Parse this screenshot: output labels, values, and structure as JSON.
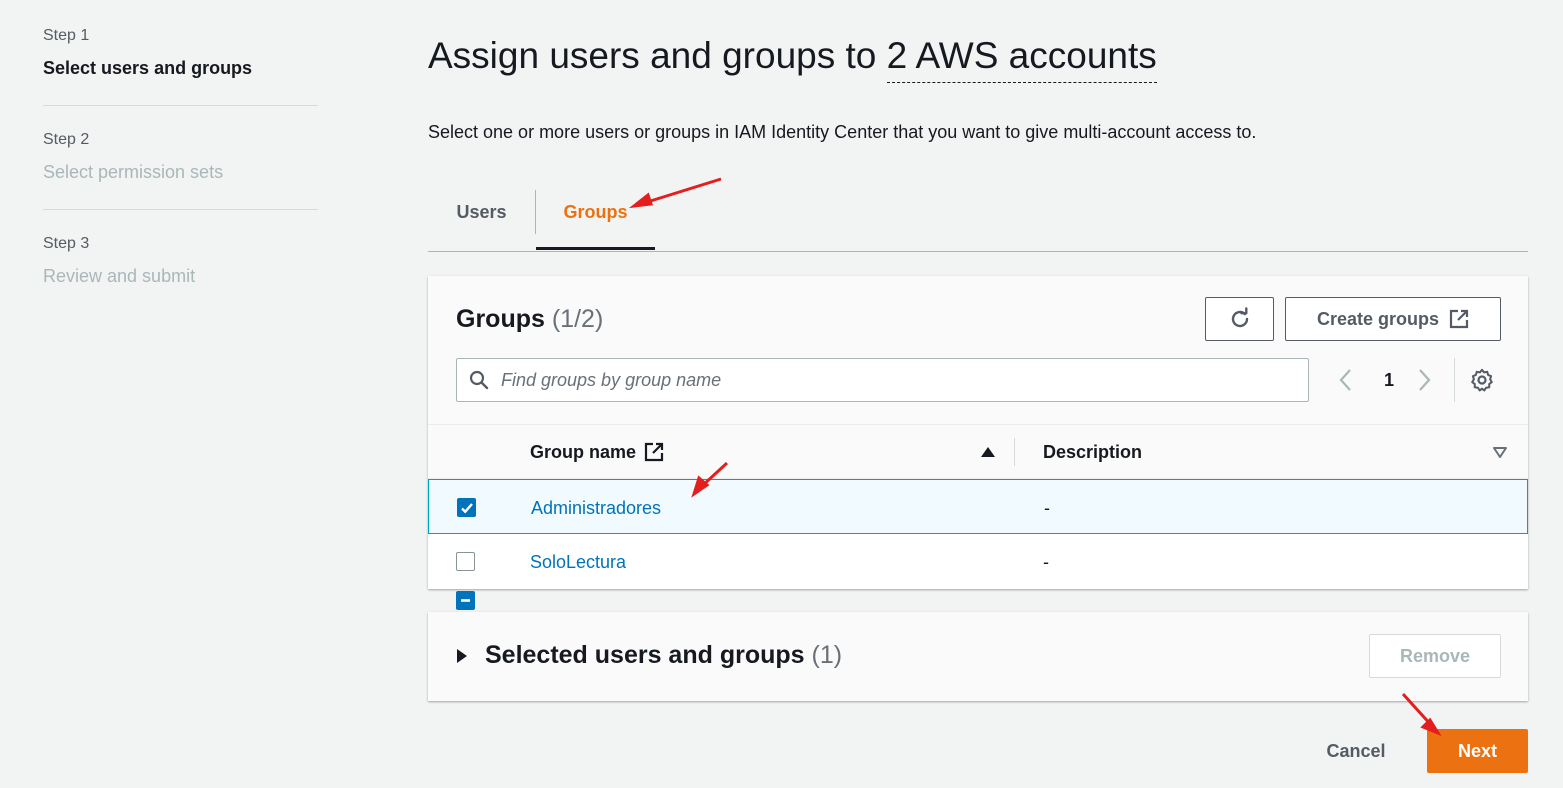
{
  "wizard": {
    "steps": [
      {
        "number": "Step 1",
        "title": "Select users and groups",
        "active": true
      },
      {
        "number": "Step 2",
        "title": "Select permission sets",
        "active": false
      },
      {
        "number": "Step 3",
        "title": "Review and submit",
        "active": false
      }
    ]
  },
  "header": {
    "title_prefix": "Assign users and groups to ",
    "title_link": "2 AWS accounts",
    "subtitle": "Select one or more users or groups in IAM Identity Center that you want to give multi-account access to."
  },
  "tabs": [
    {
      "label": "Users",
      "active": false
    },
    {
      "label": "Groups",
      "active": true
    }
  ],
  "groups_panel": {
    "title": "Groups",
    "count": "(1/2)",
    "create_label": "Create groups",
    "search_placeholder": "Find groups by group name",
    "page": "1",
    "columns": {
      "name": "Group name",
      "description": "Description"
    },
    "rows": [
      {
        "name": "Administradores",
        "description": "-",
        "selected": true
      },
      {
        "name": "SoloLectura",
        "description": "-",
        "selected": false
      }
    ]
  },
  "selected_panel": {
    "title": "Selected users and groups",
    "count": "(1)",
    "remove_label": "Remove"
  },
  "footer": {
    "cancel_label": "Cancel",
    "next_label": "Next"
  },
  "colors": {
    "accent": "#ec7211",
    "link": "#0073bb",
    "annotation": "#e41e1e"
  },
  "icons": [
    "refresh-icon",
    "external-link-icon",
    "search-icon",
    "chevron-left-icon",
    "chevron-right-icon",
    "gear-icon",
    "sort-ascending-icon",
    "sort-descending-icon",
    "caret-right-icon",
    "checkbox-indeterminate-icon",
    "checkbox-checked-icon",
    "checkbox-empty-icon",
    "annotation-arrow-icon"
  ]
}
